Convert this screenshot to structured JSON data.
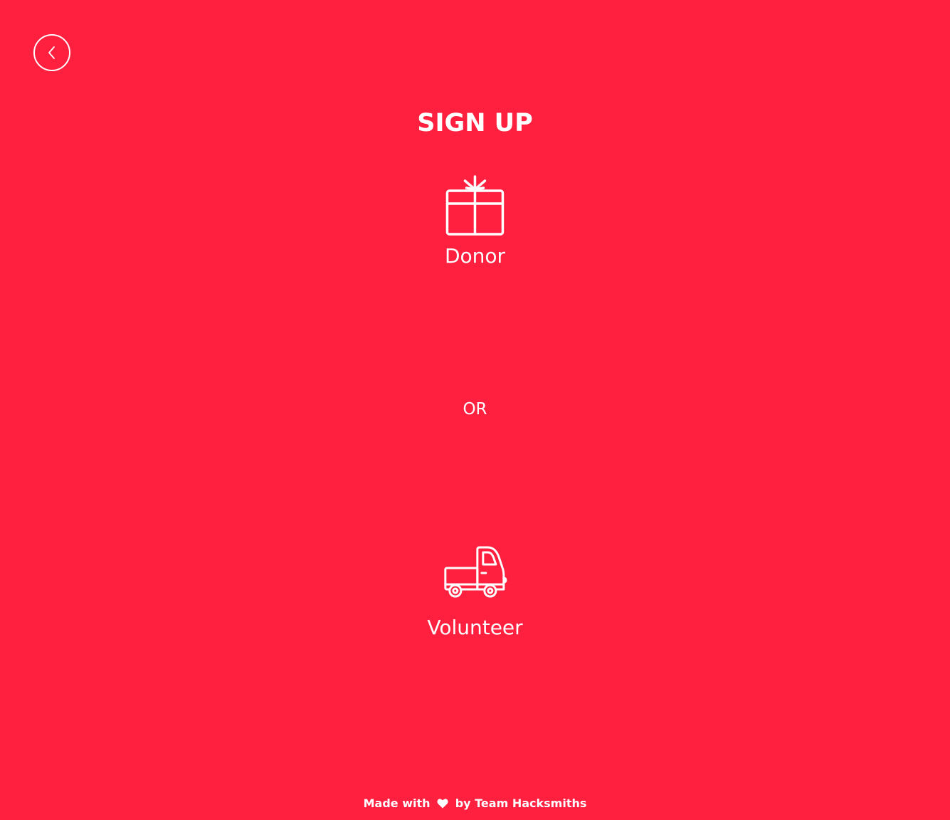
{
  "page": {
    "background_color": "#ff1f3f",
    "text_color": "#ffffff"
  },
  "back_button": {
    "icon": "chevron-left-icon"
  },
  "heading": {
    "title": "SIGN UP"
  },
  "options": {
    "donor": {
      "label": "Donor",
      "icon": "gift-icon"
    },
    "separator": "OR",
    "volunteer": {
      "label": "Volunteer",
      "icon": "truck-icon"
    }
  },
  "footer": {
    "prefix": "Made with",
    "icon": "heart-icon",
    "suffix": "by Team Hacksmiths"
  }
}
